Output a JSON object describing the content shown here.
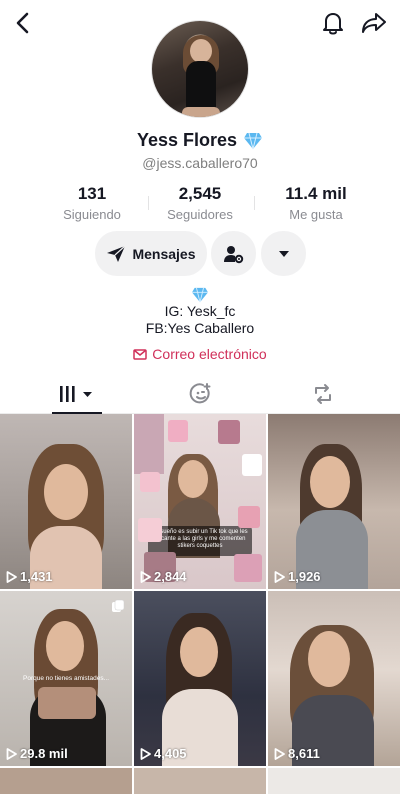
{
  "profile": {
    "name": "Yess Flores",
    "handle": "@jess.caballero70",
    "verified_icon": "diamond-icon"
  },
  "stats": [
    {
      "value": "131",
      "label": "Siguiendo"
    },
    {
      "value": "2,545",
      "label": "Seguidores"
    },
    {
      "value": "11.4 mil",
      "label": "Me gusta"
    }
  ],
  "actions": {
    "message_label": "Mensajes"
  },
  "bio": {
    "line1": "IG: Yesk_fc",
    "line2": "FB:Yes Caballero",
    "email_label": "Correo electrónico"
  },
  "videos": [
    {
      "views": "1,431"
    },
    {
      "views": "2,844"
    },
    {
      "views": "1,926"
    },
    {
      "views": "29.8 mil"
    },
    {
      "views": "4,405"
    },
    {
      "views": "8,611"
    }
  ],
  "overlay_text": {
    "v2": "Mi sueño es subir un Tik tok que les encante a las girls y me comenten stikers coquettes",
    "v4": "Porque no tienes amistades..."
  },
  "colors": {
    "accent_pink": "#d0305a",
    "text_primary": "#161823",
    "text_secondary": "#8a8b91",
    "button_bg": "#f1f1f2"
  }
}
